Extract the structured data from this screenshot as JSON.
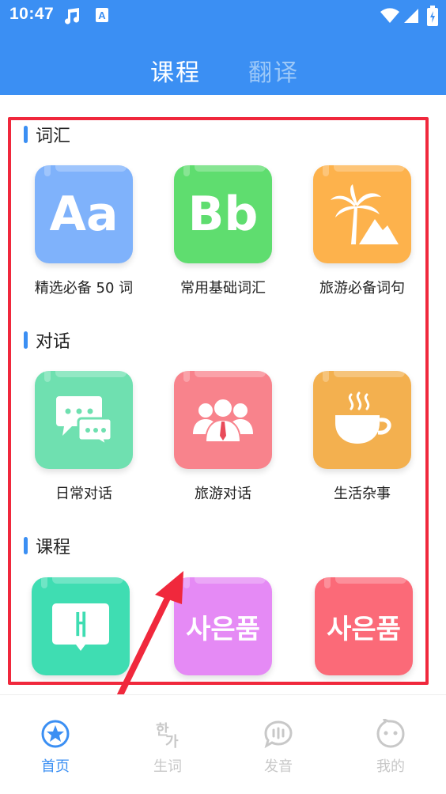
{
  "status_bar": {
    "time": "10:47",
    "icons": [
      "music-note-icon",
      "a-font-icon",
      "wifi-icon",
      "cell-signal-icon",
      "battery-icon"
    ]
  },
  "header": {
    "tabs": [
      {
        "label": "课程",
        "active": true
      },
      {
        "label": "翻译",
        "active": false
      }
    ]
  },
  "sections": [
    {
      "title": "词汇",
      "items": [
        {
          "label": "精选必备 50 词",
          "icon": "Aa",
          "color": "#7fb2fb"
        },
        {
          "label": "常用基础词汇",
          "icon": "Bb",
          "color": "#5fdd6f"
        },
        {
          "label": "旅游必备词句",
          "icon": "palm-mountain-icon",
          "color": "#fdb24c"
        }
      ]
    },
    {
      "title": "对话",
      "items": [
        {
          "label": "日常对话",
          "icon": "chat-bubbles-icon",
          "color": "#6fe0b0"
        },
        {
          "label": "旅游对话",
          "icon": "people-group-icon",
          "color": "#f8838c"
        },
        {
          "label": "生活杂事",
          "icon": "coffee-cup-icon",
          "color": "#f3b04f"
        }
      ]
    },
    {
      "title": "课程",
      "items": [
        {
          "label": "",
          "icon": "ㅐ",
          "color": "#3fddb2"
        },
        {
          "label": "",
          "icon": "사은품",
          "color": "#e58af5"
        },
        {
          "label": "",
          "icon": "사은품",
          "color": "#fb6a78"
        }
      ]
    }
  ],
  "bottom_nav": [
    {
      "label": "首页",
      "icon": "star-circle-icon",
      "active": true
    },
    {
      "label": "生词",
      "icon": "korean-word-icon",
      "active": false
    },
    {
      "label": "发音",
      "icon": "speech-bubble-icon",
      "active": false
    },
    {
      "label": "我的",
      "icon": "smiley-face-icon",
      "active": false
    }
  ],
  "colors": {
    "primary": "#3b8ff3",
    "annotation_red": "#f0283c"
  }
}
